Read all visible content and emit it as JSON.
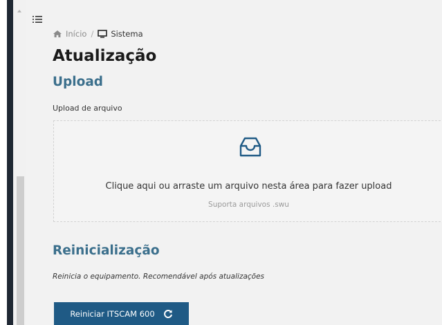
{
  "breadcrumb": {
    "home_label": "Início",
    "separator": "/",
    "current_label": "Sistema"
  },
  "page": {
    "title": "Atualização"
  },
  "upload": {
    "section_title": "Upload",
    "field_label": "Upload de arquivo",
    "dropzone_text": "Clique aqui ou arraste um arquivo nesta área para fazer upload",
    "dropzone_hint": "Suporta arquivos .swu",
    "icon": "inbox-icon"
  },
  "reboot": {
    "section_title": "Reinicialização",
    "description": "Reinicia o equipamento. Recomendável após atualizações",
    "button_label": "Reiniciar ITSCAM 600",
    "button_icon": "reload-icon"
  },
  "colors": {
    "accent": "#1f5a85",
    "section_title": "#3b6f8c",
    "sidebar_dark": "#1f2833"
  }
}
